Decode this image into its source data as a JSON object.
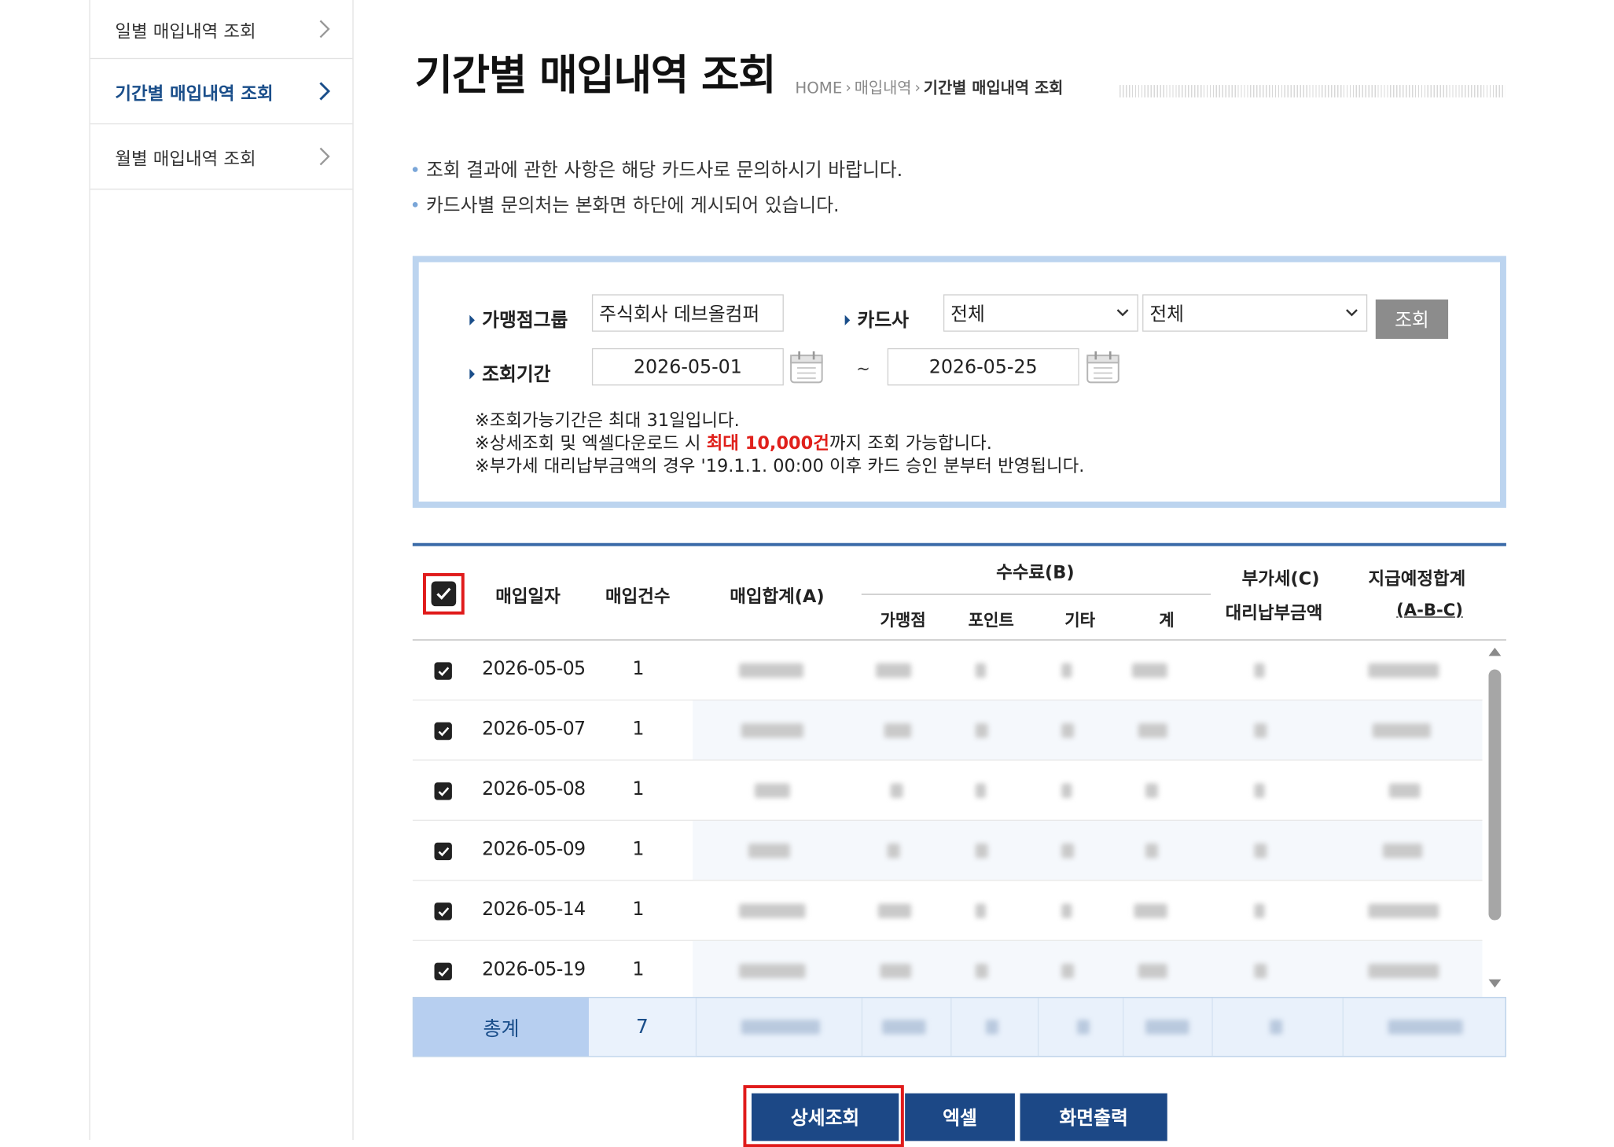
{
  "sidebar": {
    "items": [
      {
        "label": "일별 매입내역 조회",
        "active": false
      },
      {
        "label": "기간별 매입내역 조회",
        "active": true
      },
      {
        "label": "월별 매입내역 조회",
        "active": false
      }
    ]
  },
  "header": {
    "title": "기간별 매입내역 조회",
    "breadcrumb": [
      "HOME",
      "매입내역",
      "기간별 매입내역 조회"
    ]
  },
  "notices": [
    "조회 결과에 관한 사항은 해당 카드사로 문의하시기 바랍니다.",
    "카드사별 문의처는 본화면 하단에 게시되어 있습니다."
  ],
  "search": {
    "group_label": "가맹점그룹",
    "group_value": "주식회사 데브올컴퍼",
    "card_label": "카드사",
    "card_select_1": "전체",
    "card_select_2": "전체",
    "search_button": "조회",
    "period_label": "조회기간",
    "date_from": "2026-05-01",
    "date_sep": "~",
    "date_to": "2026-05-25",
    "note1": "※조회가능기간은 최대 31일입니다.",
    "note2_pre": "※상세조회 및 엑셀다운로드 시 ",
    "note2_red": "최대 10,000건",
    "note2_post": "까지 조회 가능합니다.",
    "note3": "※부가세 대리납부금액의 경우 '19.1.1. 00:00 이후 카드 승인 분부터 반영됩니다."
  },
  "table": {
    "headers": {
      "date": "매입일자",
      "count": "매입건수",
      "amount": "매입합계(A)",
      "fee": "수수료(B)",
      "fee_merchant": "가맹점",
      "fee_point": "포인트",
      "fee_etc": "기타",
      "fee_total": "계",
      "vat_line1": "부가세(C)",
      "vat_line2": "대리납부금액",
      "payout_line1": "지급예정합계",
      "payout_line2": "(A-B-C)"
    },
    "rows": [
      {
        "date": "2026-05-05",
        "count": "1",
        "checked": true
      },
      {
        "date": "2026-05-07",
        "count": "1",
        "checked": true
      },
      {
        "date": "2026-05-08",
        "count": "1",
        "checked": true
      },
      {
        "date": "2026-05-09",
        "count": "1",
        "checked": true
      },
      {
        "date": "2026-05-14",
        "count": "1",
        "checked": true
      },
      {
        "date": "2026-05-19",
        "count": "1",
        "checked": true
      }
    ],
    "total_label": "총계",
    "total_count": "7"
  },
  "buttons": {
    "detail": "상세조회",
    "excel": "엑셀",
    "print": "화면출력"
  },
  "colors": {
    "accent": "#1c4886",
    "highlight_border": "#e01b1b",
    "search_border": "#bcd4ef",
    "total_label_bg": "#b7cff0"
  }
}
